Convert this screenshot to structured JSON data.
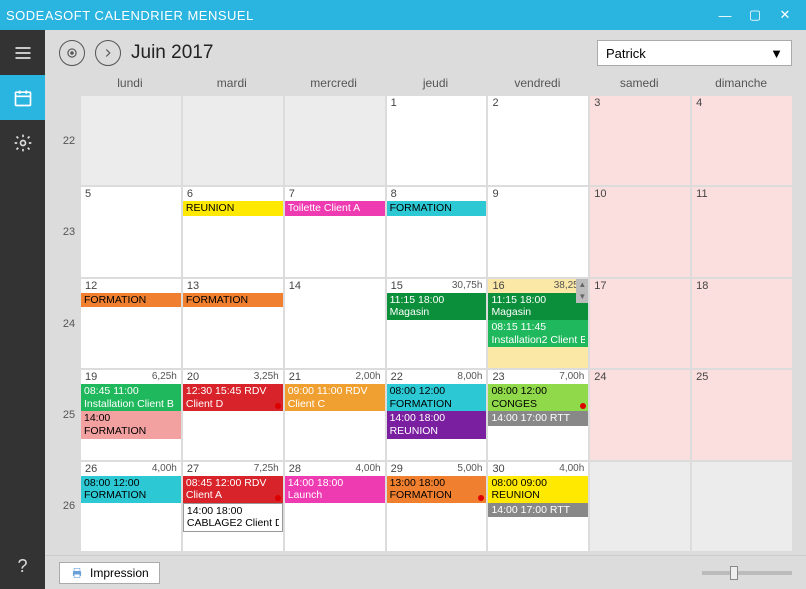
{
  "window": {
    "title": "SODEASOFT CALENDRIER MENSUEL"
  },
  "header": {
    "month_label": "Juin 2017",
    "user_selected": "Patrick"
  },
  "dow": [
    "lundi",
    "mardi",
    "mercredi",
    "jeudi",
    "vendredi",
    "samedi",
    "dimanche"
  ],
  "weeks": [
    {
      "num": "22",
      "days": [
        {
          "n": "",
          "cls": "other-month"
        },
        {
          "n": "",
          "cls": "other-month"
        },
        {
          "n": "",
          "cls": "other-month"
        },
        {
          "n": "1",
          "cls": ""
        },
        {
          "n": "2",
          "cls": ""
        },
        {
          "n": "3",
          "cls": "weekend"
        },
        {
          "n": "4",
          "cls": "weekend"
        }
      ]
    },
    {
      "num": "23",
      "days": [
        {
          "n": "5",
          "cls": ""
        },
        {
          "n": "6",
          "cls": "",
          "events": [
            {
              "label": "REUNION",
              "bg": "#ffe900"
            }
          ]
        },
        {
          "n": "7",
          "cls": "",
          "events": [
            {
              "label": "Toilette Client A",
              "bg": "#ef3bb1",
              "white": true
            }
          ]
        },
        {
          "n": "8",
          "cls": "",
          "events": [
            {
              "label": "FORMATION",
              "bg": "#2cc9d4"
            }
          ]
        },
        {
          "n": "9",
          "cls": ""
        },
        {
          "n": "10",
          "cls": "weekend"
        },
        {
          "n": "11",
          "cls": "weekend"
        }
      ]
    },
    {
      "num": "24",
      "days": [
        {
          "n": "12",
          "cls": "",
          "events": [
            {
              "label": "FORMATION",
              "bg": "#f08030"
            }
          ]
        },
        {
          "n": "13",
          "cls": "",
          "events": [
            {
              "label": "FORMATION",
              "bg": "#f08030"
            }
          ]
        },
        {
          "n": "14",
          "cls": ""
        },
        {
          "n": "15",
          "cls": "",
          "hours": "30,75h",
          "events": [
            {
              "time": "11:15 18:00",
              "label": "Magasin",
              "bg": "#0b8f3a",
              "white": true
            }
          ]
        },
        {
          "n": "16",
          "cls": "highlight",
          "hours": "38,25h",
          "scroll": true,
          "events": [
            {
              "time": "11:15 18:00",
              "label": "Magasin",
              "bg": "#0b8f3a",
              "white": true
            },
            {
              "time": "08:15 11:45",
              "label": "Installation2 Client B",
              "bg": "#1fb85c",
              "white": true
            }
          ]
        },
        {
          "n": "17",
          "cls": "weekend"
        },
        {
          "n": "18",
          "cls": "weekend"
        }
      ]
    },
    {
      "num": "25",
      "days": [
        {
          "n": "19",
          "cls": "",
          "hours": "6,25h",
          "events": [
            {
              "time": "08:45 11:00",
              "label": "Installation Client B",
              "bg": "#1fb85c",
              "white": true
            },
            {
              "time": "14:00",
              "label": "FORMATION",
              "bg": "#f3a0a0"
            }
          ]
        },
        {
          "n": "20",
          "cls": "",
          "hours": "3,25h",
          "events": [
            {
              "time": "12:30 15:45 RDV",
              "label": "Client D",
              "bg": "#d8232a",
              "white": true,
              "dot": true
            }
          ]
        },
        {
          "n": "21",
          "cls": "",
          "hours": "2,00h",
          "events": [
            {
              "time": "09:00 11:00 RDV",
              "label": "Client C",
              "bg": "#f0a030",
              "white": true
            }
          ]
        },
        {
          "n": "22",
          "cls": "",
          "hours": "8,00h",
          "events": [
            {
              "time": "08:00 12:00",
              "label": "FORMATION",
              "bg": "#2cc9d4"
            },
            {
              "time": "14:00 18:00",
              "label": "REUNION",
              "bg": "#7a1fa0",
              "white": true
            }
          ]
        },
        {
          "n": "23",
          "cls": "",
          "hours": "7,00h",
          "events": [
            {
              "time": "08:00 12:00",
              "label": "CONGES",
              "bg": "#8fd94a",
              "dot": true
            },
            {
              "time": "14:00 17:00 RTT",
              "label": "",
              "bg": "#888",
              "white": true
            }
          ]
        },
        {
          "n": "24",
          "cls": "weekend"
        },
        {
          "n": "25",
          "cls": "weekend"
        }
      ]
    },
    {
      "num": "26",
      "days": [
        {
          "n": "26",
          "cls": "",
          "hours": "4,00h",
          "events": [
            {
              "time": "08:00 12:00",
              "label": "FORMATION",
              "bg": "#2cc9d4"
            }
          ]
        },
        {
          "n": "27",
          "cls": "",
          "hours": "7,25h",
          "events": [
            {
              "time": "08:45 12:00 RDV",
              "label": "Client A",
              "bg": "#d8232a",
              "white": true,
              "dot": true
            },
            {
              "time": "14:00 18:00",
              "label": "CABLAGE2 Client D",
              "bg": "#fff",
              "border": true
            }
          ]
        },
        {
          "n": "28",
          "cls": "",
          "hours": "4,00h",
          "events": [
            {
              "time": "14:00 18:00",
              "label": "Launch",
              "bg": "#ef3bb1",
              "white": true
            }
          ]
        },
        {
          "n": "29",
          "cls": "",
          "hours": "5,00h",
          "events": [
            {
              "time": "13:00 18:00",
              "label": "FORMATION",
              "bg": "#f08030",
              "dot": true
            }
          ]
        },
        {
          "n": "30",
          "cls": "",
          "hours": "4,00h",
          "events": [
            {
              "time": "08:00 09:00",
              "label": "REUNION",
              "bg": "#ffe900"
            },
            {
              "time": "14:00 17:00 RTT",
              "label": "",
              "bg": "#888",
              "white": true
            }
          ]
        },
        {
          "n": "",
          "cls": "other-month"
        },
        {
          "n": "",
          "cls": "other-month"
        }
      ]
    }
  ],
  "footer": {
    "print_label": "Impression"
  }
}
